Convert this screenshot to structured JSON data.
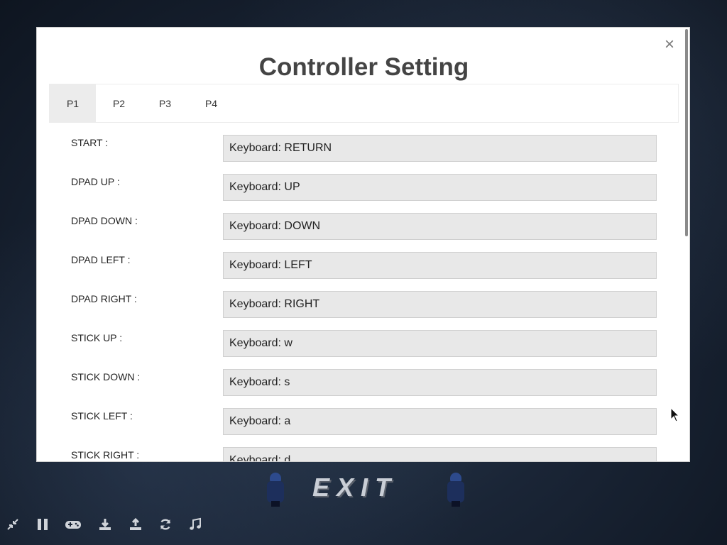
{
  "modal": {
    "title": "Controller Setting",
    "close_label": "×",
    "tabs": [
      {
        "label": "P1",
        "active": true
      },
      {
        "label": "P2",
        "active": false
      },
      {
        "label": "P3",
        "active": false
      },
      {
        "label": "P4",
        "active": false
      }
    ],
    "rows": [
      {
        "label": "START :",
        "value": "Keyboard: RETURN"
      },
      {
        "label": "DPAD UP :",
        "value": "Keyboard: UP"
      },
      {
        "label": "DPAD DOWN :",
        "value": "Keyboard: DOWN"
      },
      {
        "label": "DPAD LEFT :",
        "value": "Keyboard: LEFT"
      },
      {
        "label": "DPAD RIGHT :",
        "value": "Keyboard: RIGHT"
      },
      {
        "label": "STICK UP :",
        "value": "Keyboard: w"
      },
      {
        "label": "STICK DOWN :",
        "value": "Keyboard: s"
      },
      {
        "label": "STICK LEFT :",
        "value": "Keyboard: a"
      },
      {
        "label": "STICK RIGHT :",
        "value": "Keyboard: d"
      }
    ]
  },
  "background": {
    "exit_sign": "EXIT"
  },
  "toolbar": {
    "icons": [
      "shrink-icon",
      "pause-icon",
      "gamepad-icon",
      "download-icon",
      "upload-icon",
      "refresh-icon",
      "music-icon"
    ]
  },
  "colors": {
    "active_tab": "#ececec",
    "field_bg": "#e8e8e8",
    "title": "#444444"
  }
}
